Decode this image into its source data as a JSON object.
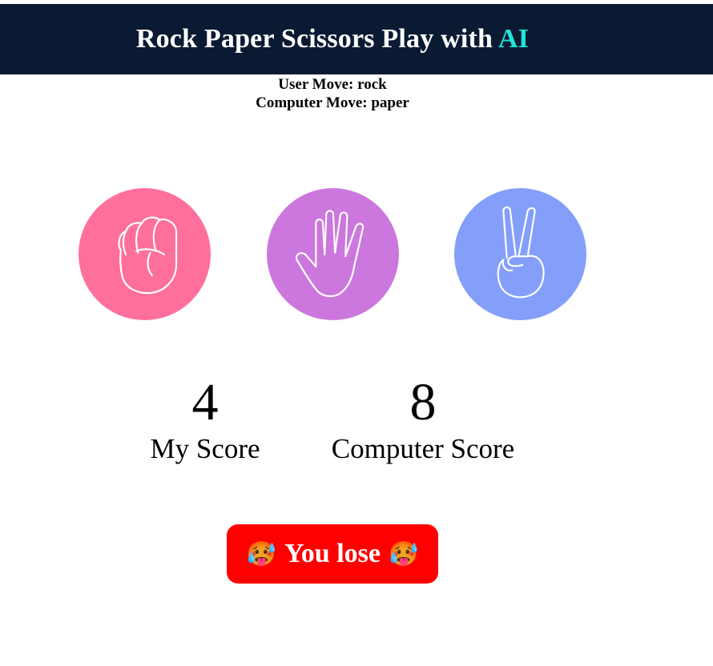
{
  "header": {
    "title": "Rock Paper Scissors Play with ",
    "title_accent": "AI",
    "accent_color": "#1fe6d8",
    "background_color": "#0b1a33"
  },
  "moves": {
    "user_move": "User Move: rock",
    "computer_move": "Computer Move: paper"
  },
  "choices": [
    {
      "name": "rock",
      "icon": "fist-icon",
      "color": "#ff6f9c"
    },
    {
      "name": "paper",
      "icon": "open-hand-icon",
      "color": "#cc77dd"
    },
    {
      "name": "scissors",
      "icon": "peace-hand-icon",
      "color": "#849ffa"
    }
  ],
  "scores": {
    "user_value": "4",
    "user_label": "My Score",
    "computer_value": "8",
    "computer_label": "Computer Score"
  },
  "result": {
    "emoji_left": "🥵",
    "text": "You lose",
    "emoji_right": "🥵",
    "color": "#ff0000"
  }
}
